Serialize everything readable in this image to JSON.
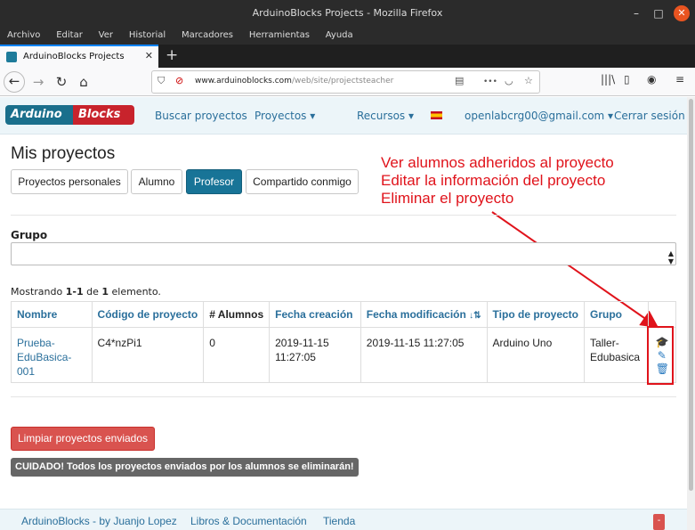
{
  "window": {
    "title": "ArduinoBlocks Projects - Mozilla Firefox",
    "minimize": "–",
    "maximize": "□",
    "close": "✕"
  },
  "menu": [
    "Archivo",
    "Editar",
    "Ver",
    "Historial",
    "Marcadores",
    "Herramientas",
    "Ayuda"
  ],
  "tab": {
    "label": "ArduinoBlocks Projects",
    "close": "✕",
    "new_tab": "+"
  },
  "navbar": {
    "url_host": "www.arduinoblocks.com",
    "url_path": "/web/site/projectsteacher",
    "more": "•••"
  },
  "site_nav": {
    "logo_left": "Arduino",
    "logo_right": "Blocks",
    "links": [
      "Buscar proyectos",
      "Proyectos ▾",
      "Recursos ▾",
      "openlabcrg00@gmail.com ▾",
      "Cerrar sesión"
    ]
  },
  "page_title": "Mis proyectos",
  "tabs": [
    "Proyectos personales",
    "Alumno",
    "Profesor",
    "Compartido conmigo"
  ],
  "annotation": [
    "Ver alumnos adheridos al proyecto",
    "Editar la información del proyecto",
    "Eliminar el proyecto"
  ],
  "group_filter": {
    "label": "Grupo",
    "value": ""
  },
  "showing": {
    "prefix": "Mostrando ",
    "range": "1-1",
    "middle": " de ",
    "total": "1",
    "suffix": " elemento."
  },
  "table": {
    "columns": [
      "Nombre",
      "Código de proyecto",
      "# Alumnos",
      "Fecha creación",
      "Fecha modificación",
      "Tipo de proyecto",
      "Grupo"
    ],
    "rows": [
      {
        "nombre": "Prueba-EduBasica-001",
        "codigo": "C4*nzPi1",
        "alumnos": "0",
        "creacion": "2019-11-15 11:27:05",
        "modificacion": "2019-11-15 11:27:05",
        "tipo": "Arduino Uno",
        "grupo": "Taller-Edubasica"
      }
    ]
  },
  "actions": {
    "students_icon": "graduation-cap-icon",
    "edit_icon": "edit-icon",
    "delete_icon": "trash-icon"
  },
  "clear_button": "Limpiar proyectos enviados",
  "warning": "CUIDADO! Todos los proyectos enviados por los alumnos se eliminarán!",
  "footer": {
    "links": [
      "ArduinoBlocks - by Juanjo Lopez",
      "Libros & Documentación",
      "Tienda"
    ],
    "button": "-"
  },
  "colors": {
    "accent": "#187497",
    "link": "#2a6f9b",
    "danger": "#d9534f",
    "annotation": "#e0131b"
  }
}
